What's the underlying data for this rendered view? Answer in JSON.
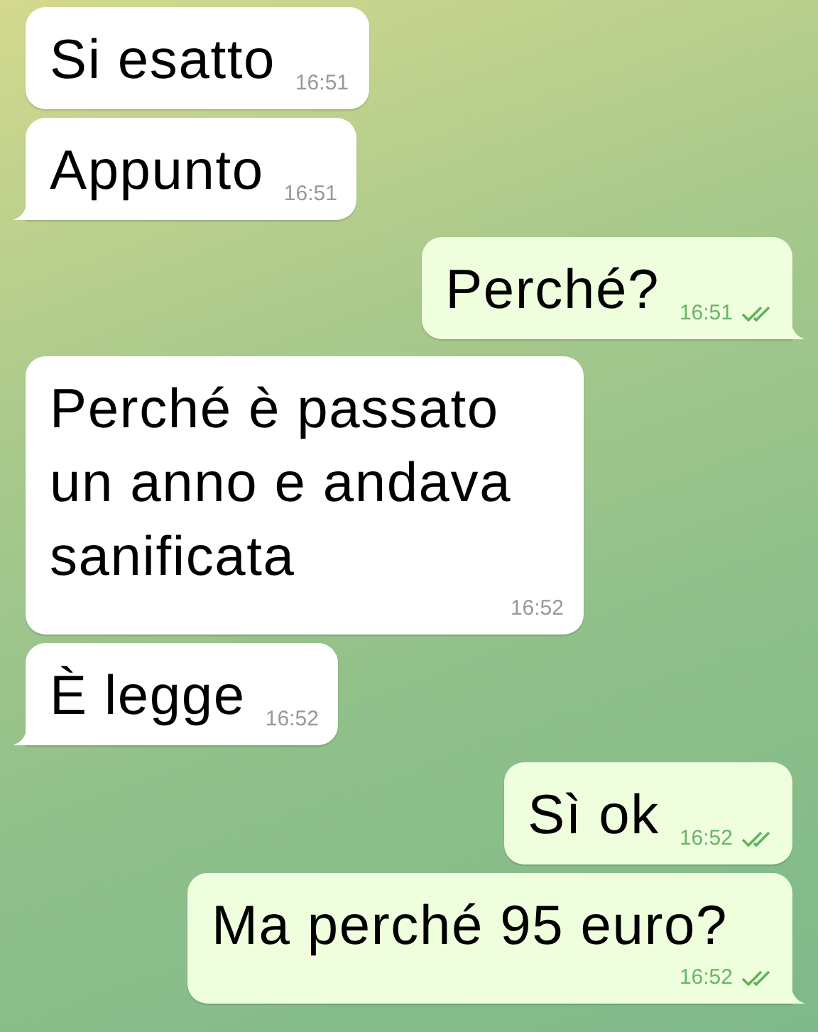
{
  "messages": [
    {
      "kind": "incoming",
      "text": "Si esatto",
      "time": "16:51",
      "tail": false
    },
    {
      "kind": "incoming",
      "text": "Appunto",
      "time": "16:51",
      "tail": true
    },
    {
      "kind": "outgoing",
      "text": "Perché?",
      "time": "16:51",
      "tail": true,
      "read": true
    },
    {
      "kind": "incoming",
      "text": "Perché è passato un anno e andava sanificata",
      "time": "16:52",
      "tail": false
    },
    {
      "kind": "incoming",
      "text": "È legge",
      "time": "16:52",
      "tail": true
    },
    {
      "kind": "outgoing",
      "text": "Sì ok",
      "time": "16:52",
      "tail": false,
      "read": true
    },
    {
      "kind": "outgoing",
      "text": "Ma perché 95 euro?",
      "time": "16:52",
      "tail": true,
      "read": true
    }
  ]
}
